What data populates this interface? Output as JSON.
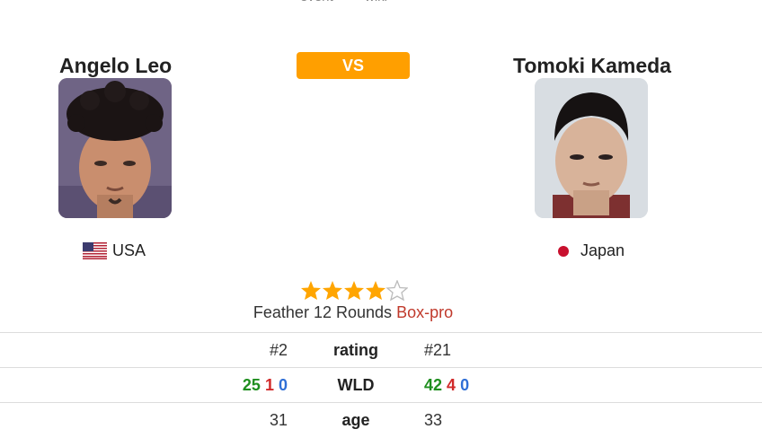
{
  "nav": {
    "items": [
      "event",
      "wiki"
    ]
  },
  "fighters": [
    {
      "name": "Angelo Leo",
      "country": "USA",
      "flag": "us-flag-icon"
    },
    {
      "name": "Tomoki Kameda",
      "country": "Japan",
      "flag": "japan-flag-icon"
    }
  ],
  "vs_label": "VS",
  "rating_stars": {
    "filled": 4,
    "total": 5,
    "color": "#ffa500"
  },
  "bout": {
    "weight_class": "Feather",
    "rounds": "12 Rounds",
    "sport_link": "Box-pro"
  },
  "stats": {
    "rating": {
      "label": "rating",
      "left": "#2",
      "right": "#21"
    },
    "wld": {
      "label": "WLD",
      "left": {
        "w": "25",
        "l": "1",
        "d": "0"
      },
      "right": {
        "w": "42",
        "l": "4",
        "d": "0"
      }
    },
    "age": {
      "label": "age",
      "left": "31",
      "right": "33"
    }
  },
  "colors": {
    "accent": "#ff9f00",
    "link": "#c0392b",
    "win": "#1e8e1e",
    "loss": "#d12a2a",
    "draw": "#2f6fd6"
  }
}
